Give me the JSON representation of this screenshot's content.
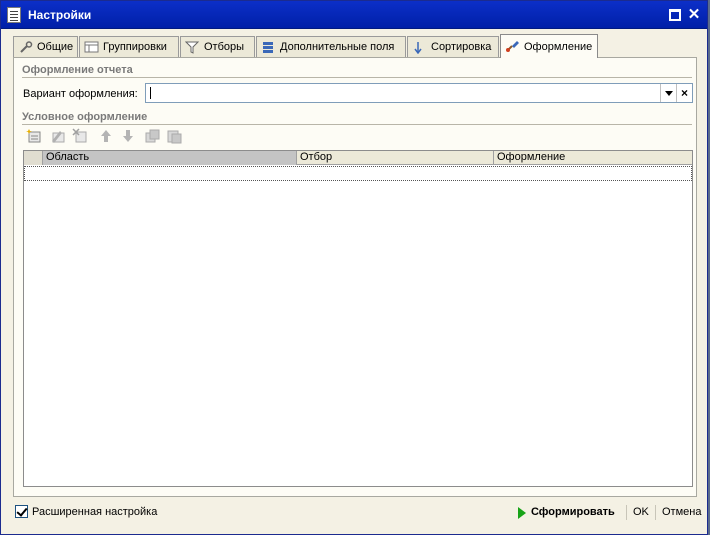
{
  "window": {
    "title": "Настройки"
  },
  "tabs": [
    {
      "label": "Общие"
    },
    {
      "label": "Группировки"
    },
    {
      "label": "Отборы"
    },
    {
      "label": "Дополнительные поля"
    },
    {
      "label": "Сортировка"
    },
    {
      "label": "Оформление"
    }
  ],
  "active_tab": "Оформление",
  "report_section": {
    "title": "Оформление отчета",
    "variant_label": "Вариант оформления:",
    "variant_value": ""
  },
  "conditional_section": {
    "title": "Условное оформление",
    "toolbar": [
      "add-icon",
      "edit-icon",
      "delete-icon",
      "move-up-icon",
      "move-down-icon",
      "copy-icon",
      "paste-icon"
    ],
    "columns": [
      "Область",
      "Отбор",
      "Оформление"
    ]
  },
  "footer": {
    "advanced_label": "Расширенная настройка",
    "advanced_checked": true,
    "generate_label": "Сформировать",
    "ok_label": "OK",
    "cancel_label": "Отмена"
  },
  "colors": {
    "titlebar": "#0c2fc8",
    "accent_green": "#17a317"
  }
}
